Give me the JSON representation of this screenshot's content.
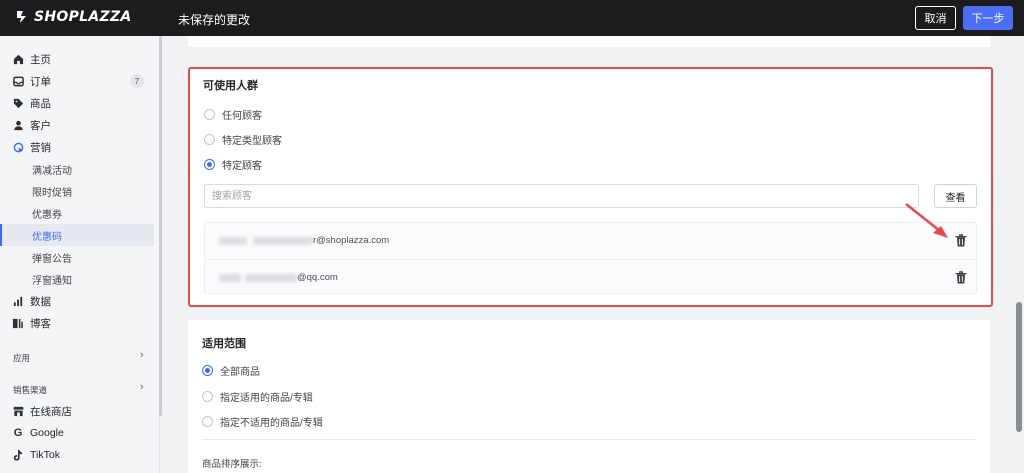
{
  "topbar": {
    "logo_text": "SHOPLAZZA",
    "unsaved_text": "未保存的更改",
    "cancel_label": "取消",
    "next_label": "下一步",
    "accent_color": "#4b6ef5"
  },
  "sidebar": {
    "items": [
      {
        "label": "主页",
        "icon": "home-icon"
      },
      {
        "label": "订单",
        "icon": "inbox-icon",
        "badge": "7"
      },
      {
        "label": "商品",
        "icon": "tag-icon"
      },
      {
        "label": "客户",
        "icon": "person-icon"
      },
      {
        "label": "营销",
        "icon": "marketing-icon"
      }
    ],
    "marketing_sub": [
      {
        "label": "满减活动"
      },
      {
        "label": "限时促销"
      },
      {
        "label": "优惠券"
      },
      {
        "label": "优惠码",
        "active": true
      },
      {
        "label": "弹窗公告"
      },
      {
        "label": "浮窗通知"
      }
    ],
    "items2": [
      {
        "label": "数据",
        "icon": "bar-chart-icon"
      },
      {
        "label": "博客",
        "icon": "blog-icon"
      }
    ],
    "apps_label": "应用",
    "channels_label": "销售渠道",
    "channels": [
      {
        "label": "在线商店",
        "icon": "store-icon"
      },
      {
        "label": "Google",
        "icon": "google-icon"
      },
      {
        "label": "TikTok",
        "icon": "tiktok-icon"
      }
    ],
    "active_color": "#3b6cf6"
  },
  "audience": {
    "title": "可使用人群",
    "options": [
      {
        "label": "任何顾客",
        "checked": false
      },
      {
        "label": "特定类型顾客",
        "checked": false
      },
      {
        "label": "特定顾客",
        "checked": true
      }
    ],
    "search_placeholder": "搜索顾客",
    "view_label": "查看",
    "customers": [
      {
        "email_suffix": "r@shoplazza.com"
      },
      {
        "email_suffix": "@qq.com"
      }
    ],
    "highlight_color": "#e84a4a"
  },
  "scope": {
    "title": "适用范围",
    "options": [
      {
        "label": "全部商品",
        "checked": true
      },
      {
        "label": "指定适用的商品/专辑",
        "checked": false
      },
      {
        "label": "指定不适用的商品/专辑",
        "checked": false
      }
    ],
    "sort_label": "商品排序展示:"
  }
}
